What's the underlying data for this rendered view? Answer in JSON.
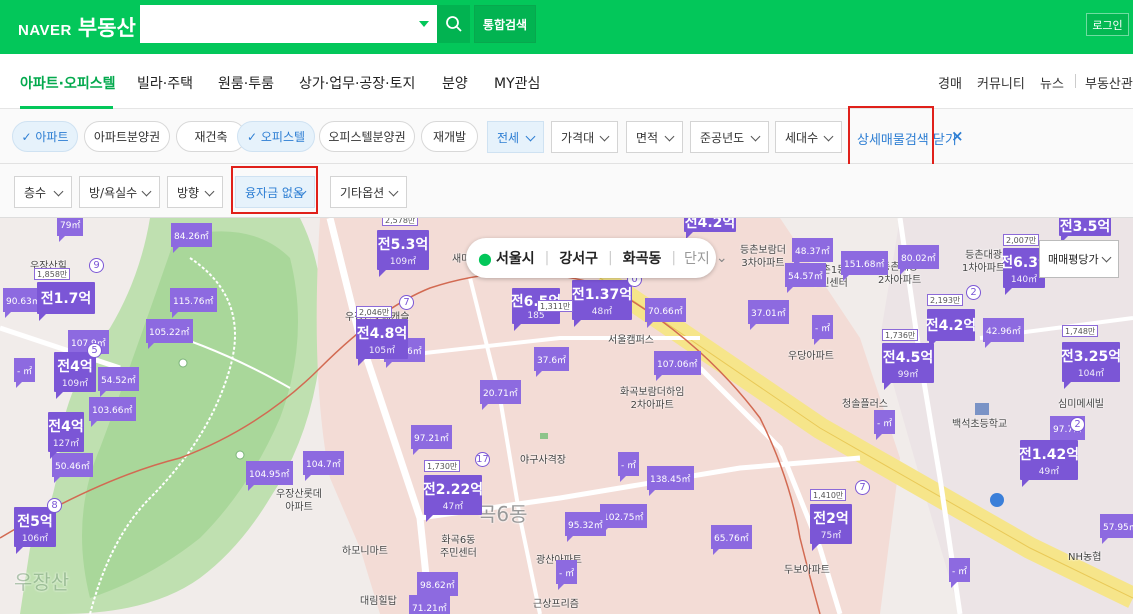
{
  "header": {
    "logo_naver": "NAVER",
    "logo_service": "부동산",
    "search_value": "",
    "total_search": "통합검색",
    "login": "로그인"
  },
  "nav": {
    "items": [
      "아파트·오피스텔",
      "빌라·주택",
      "원룸·투룸",
      "상가·업무·공장·토지",
      "분양",
      "MY관심"
    ],
    "right": [
      "경매",
      "커뮤니티",
      "뉴스",
      "부동산관리"
    ]
  },
  "filters1": {
    "chips": [
      "아파트",
      "아파트분양권",
      "재건축",
      "오피스텔",
      "오피스텔분양권",
      "재개발"
    ],
    "drops": [
      "전세",
      "가격대",
      "면적",
      "준공년도",
      "세대수"
    ],
    "advanced": "상세매물검색 닫기",
    "close": "×"
  },
  "filters2": {
    "drops": [
      "층수",
      "방/욕실수",
      "방향",
      "융자금 없음",
      "기타옵션"
    ]
  },
  "map": {
    "location": [
      "서울시",
      "강서구",
      "화곡동",
      "단지"
    ],
    "sort": "매매평당가",
    "markers": [
      {
        "p": "전5.3억",
        "a": "109㎡",
        "tag": "2,578만"
      },
      {
        "p": "전4.8억",
        "a": "105㎡",
        "tag": "2,046만",
        "n": "7"
      },
      {
        "p": "전4억",
        "a": "109㎡",
        "n": "5"
      },
      {
        "p": "전4억",
        "a": "127㎡"
      },
      {
        "p": "전5억",
        "a": "106㎡",
        "n": "8"
      },
      {
        "p": "전2.22억",
        "a": "47㎡",
        "tag": "1,730만",
        "n": "17"
      },
      {
        "p": "전1.37억",
        "a": "48㎡",
        "n": "0"
      },
      {
        "p": "전4.2억",
        "a": "",
        "n": ""
      },
      {
        "p": "전4.5억",
        "a": "99㎡",
        "tag": "1,736만"
      },
      {
        "p": "전4.2억",
        "a": "",
        "tag": "2,193만",
        "n": "2"
      },
      {
        "p": "전3.25억",
        "a": "104㎡",
        "tag": "1,748만"
      },
      {
        "p": "전1.42억",
        "a": "49㎡",
        "n": "2"
      },
      {
        "p": "전2억",
        "a": "75㎡",
        "tag": "1,410만",
        "n": "7"
      },
      {
        "p": "전6.39",
        "a": "140㎡",
        "tag": "2,007만"
      },
      {
        "p": "전3.5억",
        "a": "85㎡"
      },
      {
        "p": "전1.7억",
        "a": "",
        "tag": "1,858만",
        "n": "9"
      },
      {
        "p": "전6.5억",
        "a": "185",
        "tag": "1,311만"
      }
    ],
    "small": [
      "79㎡",
      "84.26㎡",
      "90.63㎡",
      "115.76㎡",
      "105.22㎡",
      "107.9㎡",
      "54.52㎡",
      "103.66㎡",
      "50.46㎡",
      "95.26㎡",
      "104.95㎡",
      "104.7㎡",
      "97.21㎡",
      "20.71㎡",
      "37.6㎡",
      "70.66㎡",
      "107.06㎡",
      "138.45㎡",
      "102.75㎡",
      "95.32㎡",
      "65.76㎡",
      "98.62㎡",
      "71.21㎡",
      "37.01㎡",
      "48.37㎡",
      "54.57㎡",
      "151.68㎡",
      "80.02㎡",
      "42.96㎡",
      "97.7㎡",
      "57.95㎡",
      "- ㎡",
      "- ㎡",
      "- ㎡",
      "- ㎡",
      "- ㎡",
      "- ㎡"
    ],
    "labels": [
      "우장산롯데캐슬",
      "우장산롯데\n아파트",
      "화곡보람더하임\n2차아파트",
      "야구사격장",
      "화곡6동\n주민센터",
      "서울캠퍼스",
      "우당아파트",
      "두보아파트",
      "청솔플러스",
      "백석초등학교",
      "심미메세빌",
      "하모니마트",
      "대림힐탑",
      "근상프리즘",
      "광산아파트",
      "등촌보람더\n3차아파트",
      "등촌1동\n주민센터",
      "등촌대광\n2차아파트",
      "등촌대광\n1차아파트",
      "우장산",
      "NH농협",
      "새마",
      "곡6동",
      "우장산힐"
    ]
  },
  "colors": {
    "brand": "#03c75a",
    "marker": "#7b56d6",
    "highlight": "#e0201a",
    "link": "#2d7ed3"
  }
}
